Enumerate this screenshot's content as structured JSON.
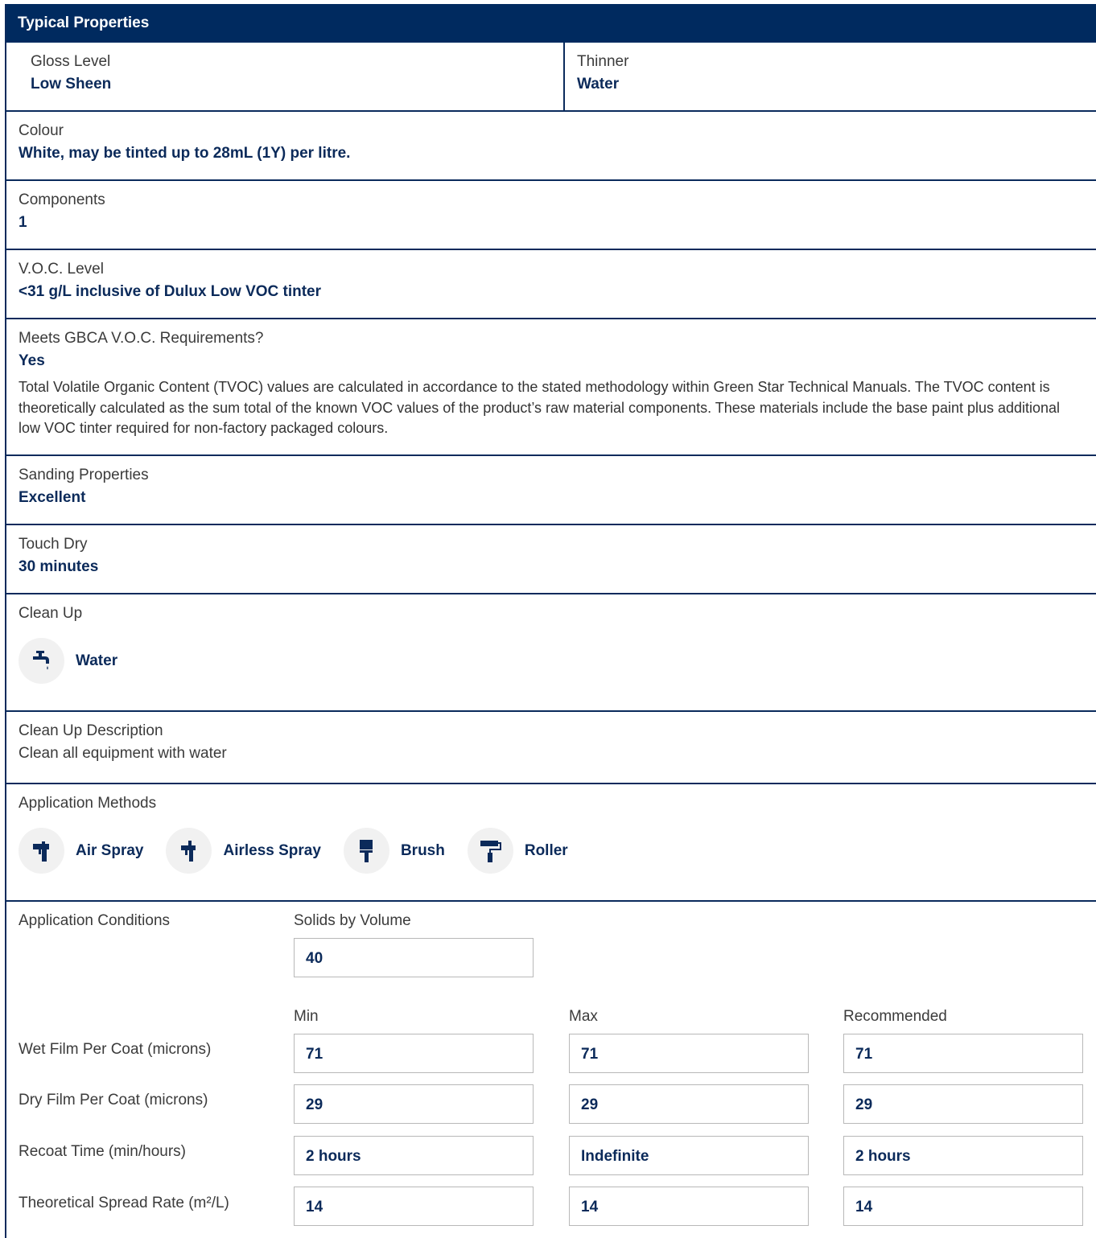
{
  "title": "Typical Properties",
  "gloss": {
    "label": "Gloss Level",
    "value": "Low Sheen"
  },
  "thinner": {
    "label": "Thinner",
    "value": "Water"
  },
  "colour": {
    "label": "Colour",
    "value": "White, may be tinted up to 28mL (1Y) per litre."
  },
  "components": {
    "label": "Components",
    "value": "1"
  },
  "voc": {
    "label": "V.O.C. Level",
    "value": "<31 g/L inclusive of Dulux Low VOC tinter"
  },
  "gbca": {
    "label": "Meets GBCA V.O.C. Requirements?",
    "value": "Yes",
    "description": "Total Volatile Organic Content (TVOC) values are calculated in accordance to the stated methodology within Green Star Technical Manuals. The TVOC content is theoretically calculated as the sum total of the known VOC values of the product’s raw material components. These materials include the base paint plus additional low VOC tinter required for non-factory packaged colours."
  },
  "sanding": {
    "label": "Sanding Properties",
    "value": "Excellent"
  },
  "touch_dry": {
    "label": "Touch Dry",
    "value": "30 minutes"
  },
  "clean_up": {
    "label": "Clean Up",
    "items": [
      {
        "label": "Water",
        "icon": "tap-icon"
      }
    ]
  },
  "clean_up_desc": {
    "label": "Clean Up Description",
    "value": "Clean all equipment with water"
  },
  "application_methods": {
    "label": "Application Methods",
    "items": [
      {
        "label": "Air Spray",
        "icon": "air-spray-icon"
      },
      {
        "label": "Airless Spray",
        "icon": "airless-spray-icon"
      },
      {
        "label": "Brush",
        "icon": "brush-icon"
      },
      {
        "label": "Roller",
        "icon": "roller-icon"
      }
    ]
  },
  "conditions": {
    "label": "Application Conditions",
    "solids_label": "Solids by Volume",
    "solids_value": "40",
    "columns": [
      "Min",
      "Max",
      "Recommended"
    ],
    "rows": [
      {
        "label": "Wet Film Per Coat (microns)",
        "values": [
          "71",
          "71",
          "71"
        ]
      },
      {
        "label": "Dry Film Per Coat (microns)",
        "values": [
          "29",
          "29",
          "29"
        ]
      },
      {
        "label": "Recoat Time (min/hours)",
        "values": [
          "2 hours",
          "Indefinite",
          "2 hours"
        ]
      },
      {
        "label": "Theoretical Spread Rate (m²/L)",
        "values": [
          "14",
          "14",
          "14"
        ]
      }
    ]
  },
  "colors": {
    "header_bg": "#002a5f",
    "value_text": "#0b2a5a",
    "border": "#0a2a5c"
  }
}
